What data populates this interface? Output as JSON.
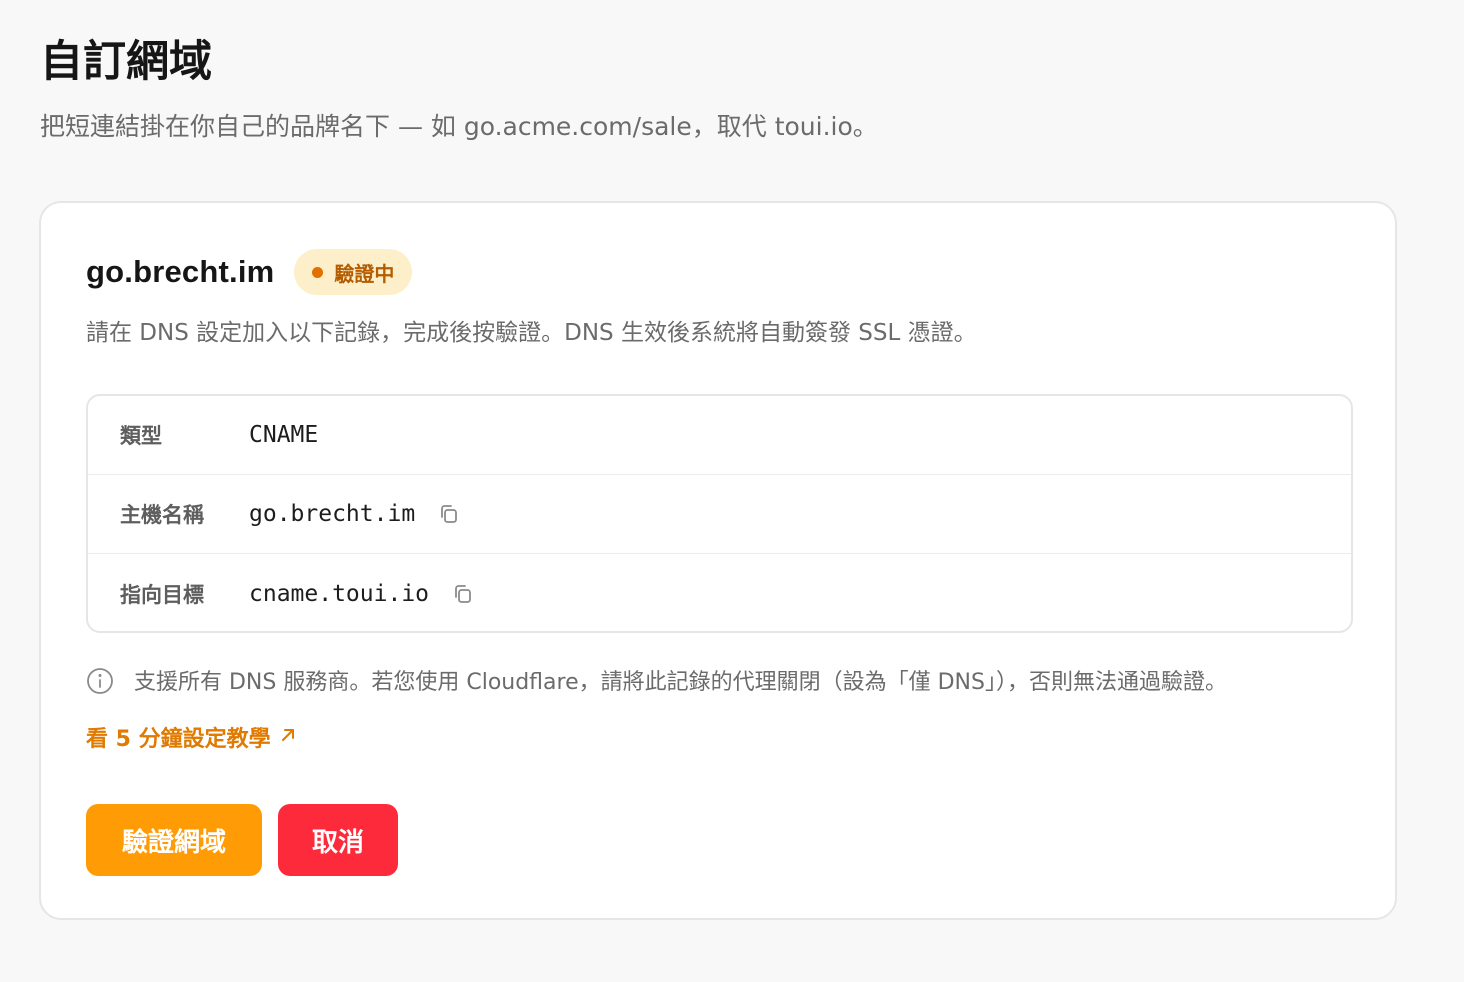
{
  "header": {
    "title": "自訂網域",
    "subtitle": "把短連結掛在你自己的品牌名下 — 如 go.acme.com/sale，取代 toui.io。"
  },
  "domain": {
    "name": "go.brecht.im",
    "status": "驗證中",
    "status_color": "#e07000",
    "instructions": "請在 DNS 設定加入以下記錄，完成後按驗證。DNS 生效後系統將自動簽發 SSL 憑證。"
  },
  "records": [
    {
      "label": "類型",
      "value": "CNAME",
      "copyable": false
    },
    {
      "label": "主機名稱",
      "value": "go.brecht.im",
      "copyable": true,
      "icon": "copy-icon"
    },
    {
      "label": "指向目標",
      "value": "cname.toui.io",
      "copyable": true,
      "icon": "copy-icon"
    }
  ],
  "note": {
    "icon": "info-icon",
    "text": "支援所有 DNS 服務商。若您使用 Cloudflare，請將此記錄的代理關閉（設為「僅 DNS」），否則無法通過驗證。"
  },
  "tutorial": {
    "label": "看 5 分鐘設定教學",
    "icon": "external-arrow-icon",
    "color": "#e07a00"
  },
  "actions": {
    "verify_label": "驗證網域",
    "verify_color": "#ff9b05",
    "cancel_label": "取消",
    "cancel_color": "#fd2a3b"
  }
}
